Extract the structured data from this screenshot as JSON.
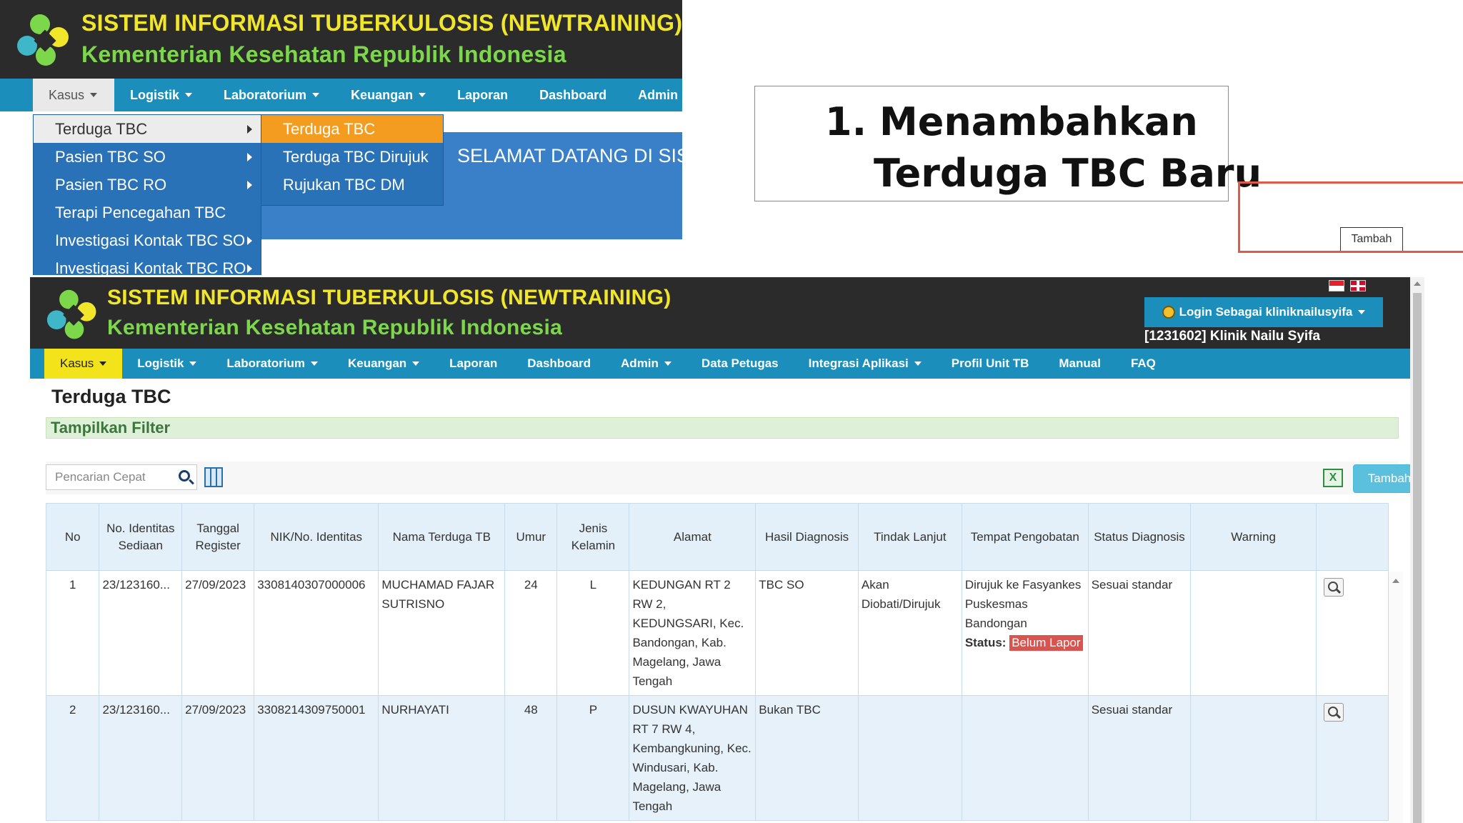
{
  "app": {
    "title": "SISTEM INFORMASI TUBERKULOSIS (NEWTRAINING)",
    "subtitle": "Kementerian Kesehatan Republik Indonesia"
  },
  "shot1": {
    "nav": [
      "Kasus",
      "Logistik",
      "Laboratorium",
      "Keuangan",
      "Laporan",
      "Dashboard",
      "Admin"
    ],
    "menu_level1": [
      "Terduga TBC",
      "Pasien TBC SO",
      "Pasien TBC RO",
      "Terapi Pencegahan TBC",
      "Investigasi Kontak TBC SO",
      "Investigasi Kontak TBC RO"
    ],
    "menu_level2": [
      "Terduga TBC",
      "Terduga TBC Dirujuk",
      "Rujukan TBC DM"
    ],
    "welcome": "SELAMAT DATANG DI SIS"
  },
  "annotation": {
    "number": "1.",
    "line1": "Menambahkan",
    "line2": "Terduga TBC Baru"
  },
  "shot2": {
    "login_label": "Login Sebagai kliniknailusyifa",
    "clinic": "[1231602] Klinik Nailu Syifa",
    "nav": [
      "Kasus",
      "Logistik",
      "Laboratorium",
      "Keuangan",
      "Laporan",
      "Dashboard",
      "Admin",
      "Data Petugas",
      "Integrasi Aplikasi",
      "Profil Unit TB",
      "Manual",
      "FAQ"
    ],
    "page_title": "Terduga TBC",
    "filter_label": "Tampilkan Filter",
    "search_placeholder": "Pencarian Cepat",
    "excel_icon": "X",
    "add_button": "Tambah",
    "tooltip": "Tambah",
    "columns": [
      "No",
      "No. Identitas Sediaan",
      "Tanggal Register",
      "NIK/No. Identitas",
      "Nama Terduga TB",
      "Umur",
      "Jenis Kelamin",
      "Alamat",
      "Hasil Diagnosis",
      "Tindak Lanjut",
      "Tempat Pengobatan",
      "Status Diagnosis",
      "Warning",
      ""
    ],
    "rows": [
      {
        "no": "1",
        "sediaan": "23/123160...",
        "tanggal": "27/09/2023",
        "nik": "3308140307000006",
        "nama": "MUCHAMAD FAJAR SUTRISNO",
        "umur": "24",
        "jk": "L",
        "alamat": "KEDUNGAN RT 2 RW 2, KEDUNGSARI, Kec. Bandongan, Kab. Magelang, Jawa Tengah",
        "hasil": "TBC SO",
        "tindak": "Akan Diobati/Dirujuk",
        "tempat": "Dirujuk ke Fasyankes Puskesmas Bandongan",
        "tempat_status_label": "Status:",
        "tempat_status": "Belum Lapor",
        "status_diag": "Sesuai standar",
        "warning": ""
      },
      {
        "no": "2",
        "sediaan": "23/123160...",
        "tanggal": "27/09/2023",
        "nik": "3308214309750001",
        "nama": "NURHAYATI",
        "umur": "48",
        "jk": "P",
        "alamat": "DUSUN KWAYUHAN RT 7 RW 4, Kembangkuning, Kec. Windusari, Kab. Magelang, Jawa Tengah",
        "hasil": "Bukan TBC",
        "tindak": "",
        "tempat": "",
        "status_diag": "Sesuai standar",
        "warning": ""
      }
    ]
  },
  "colors": {
    "header_bg": "#2b2b2b",
    "title_yellow": "#f2e62a",
    "subtitle_green": "#7cd84a",
    "nav_blue": "#1b8ebc",
    "menu_blue": "#2a72b8",
    "menu_highlight": "#f39c1f",
    "active_tab_yellow": "#f3e31b",
    "add_button": "#5bc0de",
    "badge_red": "#d9534f",
    "callout_red": "#e05a4a"
  }
}
